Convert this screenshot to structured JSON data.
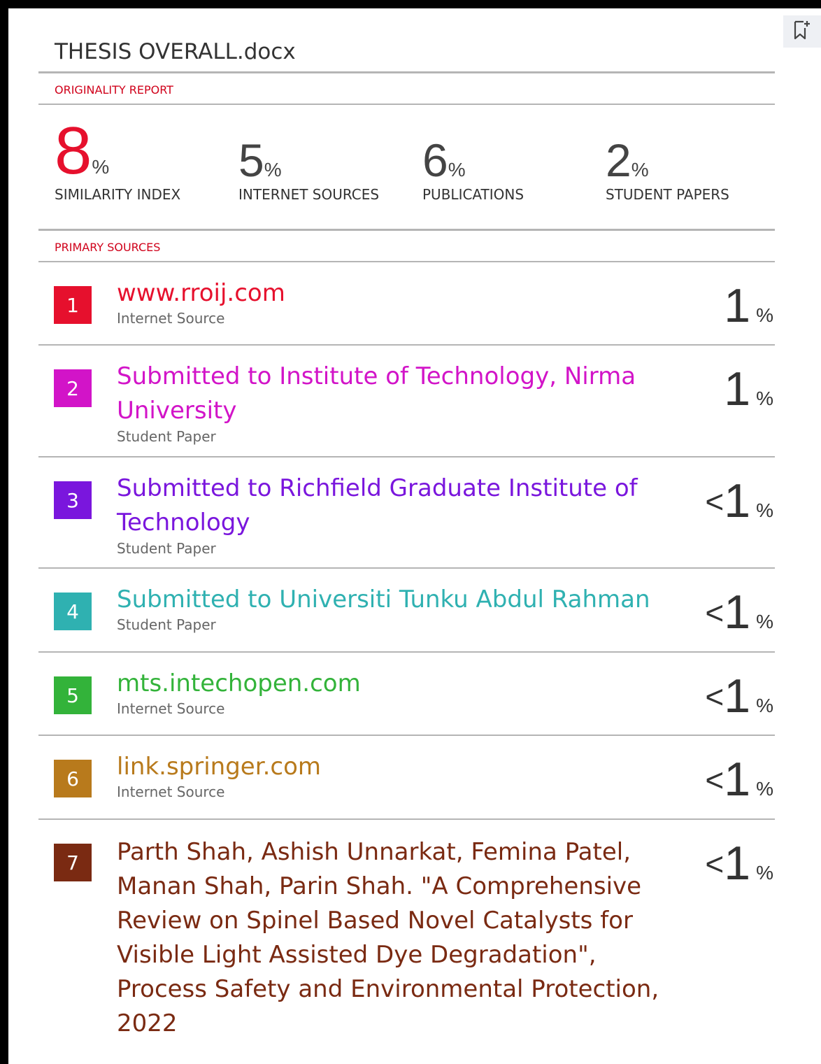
{
  "document": {
    "title": "THESIS OVERALL.docx",
    "section_label": "ORIGINALITY REPORT"
  },
  "stats": [
    {
      "value": "8",
      "unit": "%",
      "label": "SIMILARITY INDEX"
    },
    {
      "value": "5",
      "unit": "%",
      "label": "INTERNET SOURCES"
    },
    {
      "value": "6",
      "unit": "%",
      "label": "PUBLICATIONS"
    },
    {
      "value": "2",
      "unit": "%",
      "label": "STUDENT PAPERS"
    }
  ],
  "primary_sources": {
    "label": "PRIMARY SOURCES",
    "items": [
      {
        "rank": "1",
        "color": "#e6102d",
        "title": "www.rroij.com",
        "type": "Internet Source",
        "prefix": "",
        "value": "1",
        "unit": "%"
      },
      {
        "rank": "2",
        "color": "#d214c8",
        "title": "Submitted to Institute of Technology, Nirma University",
        "type": "Student Paper",
        "prefix": "",
        "value": "1",
        "unit": "%"
      },
      {
        "rank": "3",
        "color": "#7a16dd",
        "title": "Submitted to Richfield Graduate Institute of Technology",
        "type": "Student Paper",
        "prefix": "<",
        "value": "1",
        "unit": "%"
      },
      {
        "rank": "4",
        "color": "#2fb1b1",
        "title": "Submitted to Universiti Tunku Abdul Rahman",
        "type": "Student Paper",
        "prefix": "<",
        "value": "1",
        "unit": "%"
      },
      {
        "rank": "5",
        "color": "#33b33a",
        "title": "mts.intechopen.com",
        "type": "Internet Source",
        "prefix": "<",
        "value": "1",
        "unit": "%"
      },
      {
        "rank": "6",
        "color": "#b87a1c",
        "title": "link.springer.com",
        "type": "Internet Source",
        "prefix": "<",
        "value": "1",
        "unit": "%"
      },
      {
        "rank": "7",
        "color": "#7a2a12",
        "title": "Parth Shah, Ashish Unnarkat, Femina Patel, Manan Shah, Parin Shah. \"A Comprehensive Review on Spinel Based Novel Catalysts for Visible Light Assisted Dye Degradation\", Process Safety and Environmental Protection, 2022",
        "type": "",
        "prefix": "<",
        "value": "1",
        "unit": "%"
      }
    ]
  },
  "icons": {
    "bookmark": "bookmark-add-icon"
  }
}
